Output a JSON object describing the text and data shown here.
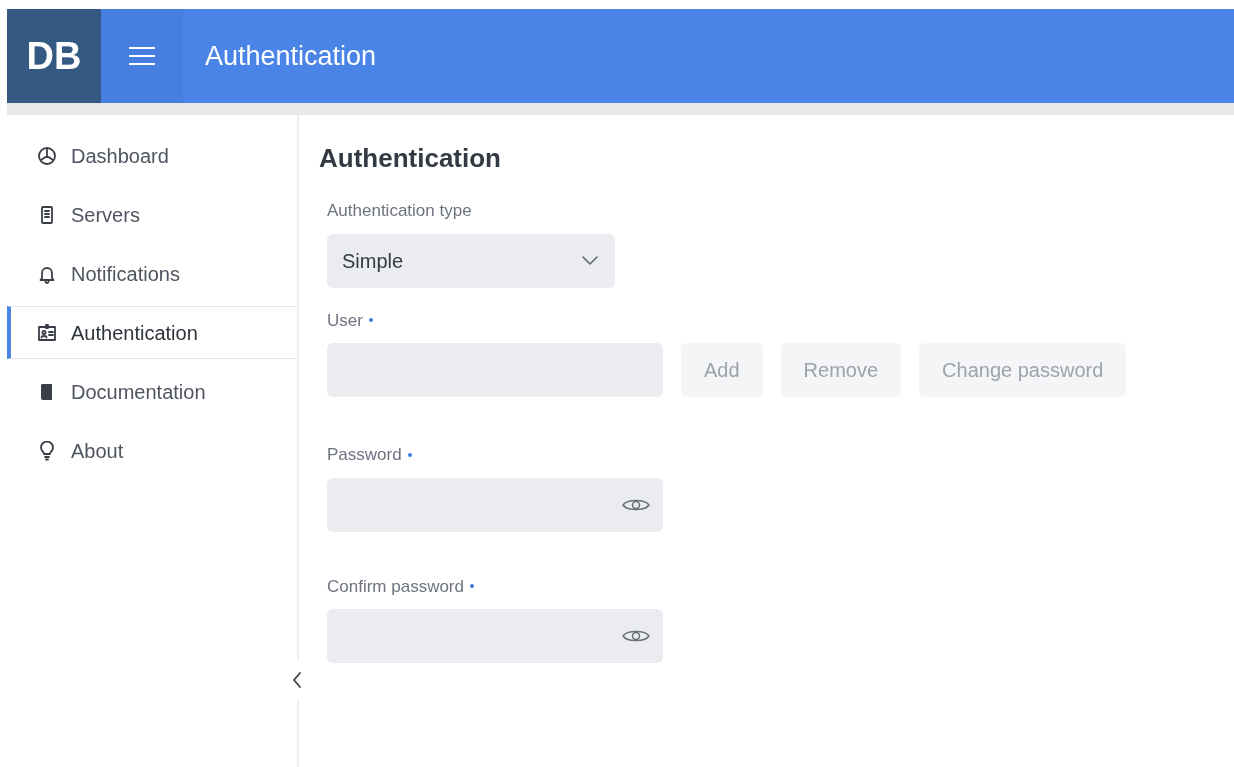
{
  "header": {
    "logo": "DB",
    "title": "Authentication"
  },
  "sidebar": {
    "items": [
      {
        "label": "Dashboard",
        "selected": false
      },
      {
        "label": "Servers",
        "selected": false
      },
      {
        "label": "Notifications",
        "selected": false
      },
      {
        "label": "Authentication",
        "selected": true
      },
      {
        "label": "Documentation",
        "selected": false
      },
      {
        "label": "About",
        "selected": false
      }
    ]
  },
  "page": {
    "heading": "Authentication",
    "fields": [
      {
        "kind": "select",
        "label": "Authentication type",
        "value": "Simple"
      },
      {
        "kind": "text",
        "label": "User",
        "required": true,
        "buttons": [
          {
            "label": "Add",
            "disabled": true
          },
          {
            "label": "Remove",
            "disabled": true
          },
          {
            "label": "Change password",
            "disabled": true
          }
        ]
      },
      {
        "kind": "password",
        "label": "Password",
        "required": true
      },
      {
        "kind": "password",
        "label": "Confirm password",
        "required": true
      }
    ]
  }
}
